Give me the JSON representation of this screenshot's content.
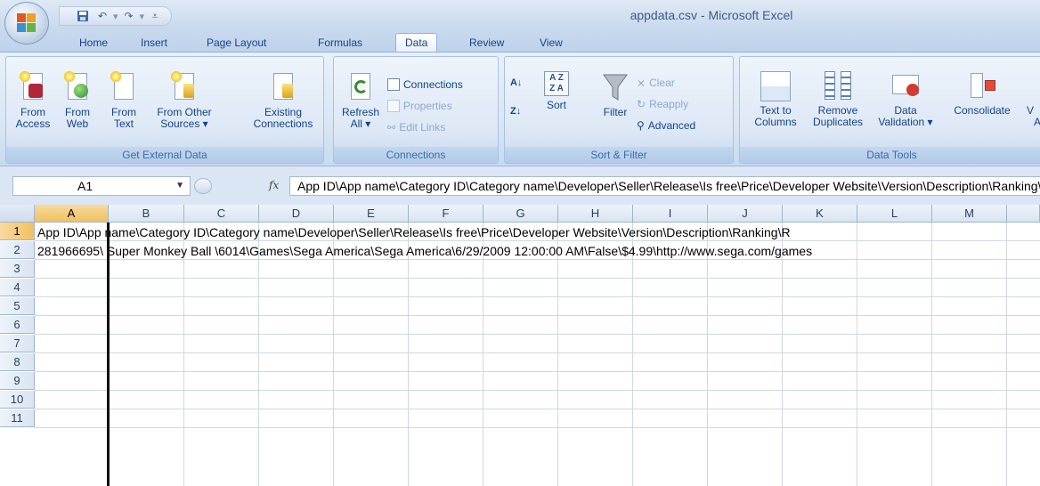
{
  "window": {
    "title": "appdata.csv - Microsoft Excel"
  },
  "quick_access": {
    "save_icon": "save-icon",
    "undo_icon": "undo-icon",
    "redo_icon": "redo-icon",
    "customize_icon": "customize-qat-icon"
  },
  "tabs": [
    {
      "label": "Home"
    },
    {
      "label": "Insert"
    },
    {
      "label": "Page Layout"
    },
    {
      "label": "Formulas"
    },
    {
      "label": "Data",
      "active": true
    },
    {
      "label": "Review"
    },
    {
      "label": "View"
    }
  ],
  "ribbon": {
    "get_external": {
      "label": "Get External Data",
      "from_access": [
        "From",
        "Access"
      ],
      "from_web": [
        "From",
        "Web"
      ],
      "from_text": [
        "From",
        "Text"
      ],
      "from_other": [
        "From Other",
        "Sources ▾"
      ],
      "existing": [
        "Existing",
        "Connections"
      ]
    },
    "connections": {
      "label": "Connections",
      "refresh": [
        "Refresh",
        "All ▾"
      ],
      "connections": "Connections",
      "properties": "Properties",
      "edit_links": "Edit Links"
    },
    "sort_filter": {
      "label": "Sort & Filter",
      "sort": "Sort",
      "filter": "Filter",
      "clear": "Clear",
      "reapply": "Reapply",
      "advanced": "Advanced"
    },
    "data_tools": {
      "label": "Data Tools",
      "text_to_columns": [
        "Text to",
        "Columns"
      ],
      "remove_duplicates": [
        "Remove",
        "Duplicates"
      ],
      "data_validation": [
        "Data",
        "Validation ▾"
      ],
      "consolidate": "Consolidate",
      "whatif_partial": [
        "V",
        "A"
      ]
    }
  },
  "formula_bar": {
    "name_box": "A1",
    "fx": "fx",
    "formula": "App ID\\App name\\Category ID\\Category name\\Developer\\Seller\\Release\\Is free\\Price\\Developer Website\\Version\\Description\\Ranking\\"
  },
  "grid": {
    "columns": [
      "A",
      "B",
      "C",
      "D",
      "E",
      "F",
      "G",
      "H",
      "I",
      "J",
      "K",
      "L",
      "M"
    ],
    "rows": [
      "1",
      "2",
      "3",
      "4",
      "5",
      "6",
      "7",
      "8",
      "9",
      "10",
      "11"
    ],
    "cells": {
      "A1": "App ID\\App name\\Category ID\\Category name\\Developer\\Seller\\Release\\Is free\\Price\\Developer Website\\Version\\Description\\Ranking\\R",
      "A2": "281966695\\ Super Monkey Ball \\6014\\Games\\Sega America\\Sega America\\6/29/2009 12:00:00 AM\\False\\$4.99\\http://www.sega.com/games"
    }
  }
}
